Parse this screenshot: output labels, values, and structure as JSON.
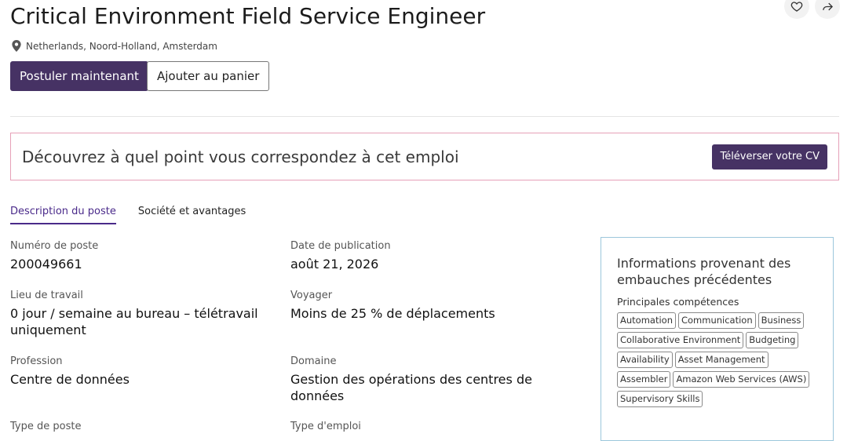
{
  "header": {
    "title": "Critical Environment Field Service Engineer",
    "location": "Netherlands, Noord-Holland, Amsterdam",
    "apply_label": "Postuler maintenant",
    "cart_label": "Ajouter au panier",
    "icons": [
      "heart-icon",
      "share-icon",
      "location-pin-icon"
    ]
  },
  "banner": {
    "text": "Découvrez à quel point vous correspondez à cet emploi",
    "upload_label": "Téléverser votre CV",
    "border_color": "#e6a0b8"
  },
  "tabs": [
    {
      "label": "Description du poste",
      "active": true
    },
    {
      "label": "Société et avantages",
      "active": false
    }
  ],
  "details": {
    "job_number": {
      "label": "Numéro de poste",
      "value": "200049661"
    },
    "posted_date": {
      "label": "Date de publication",
      "value": "août 21, 2026"
    },
    "workplace": {
      "label": "Lieu de travail",
      "value": "0 jour / semaine au bureau – télétravail uniquement"
    },
    "travel": {
      "label": "Voyager",
      "value": "Moins de 25 % de déplacements"
    },
    "profession": {
      "label": "Profession",
      "value": "Centre de données"
    },
    "domain": {
      "label": "Domaine",
      "value": "Gestion des opérations des centres de données"
    },
    "role_type": {
      "label": "Type de poste"
    },
    "employment_type": {
      "label": "Type d'emploi"
    }
  },
  "insights": {
    "title": "Informations provenant des embauches précédentes",
    "skills_label": "Principales compétences",
    "skills": [
      "Automation",
      "Communication",
      "Business",
      "Collaborative Environment",
      "Budgeting",
      "Availability",
      "Asset Management",
      "Assembler",
      "Amazon Web Services (AWS)",
      "Supervisory Skills"
    ]
  },
  "colors": {
    "primary": "#463264",
    "accent": "#4a2a8a",
    "panel_border": "#9cc7dc"
  }
}
